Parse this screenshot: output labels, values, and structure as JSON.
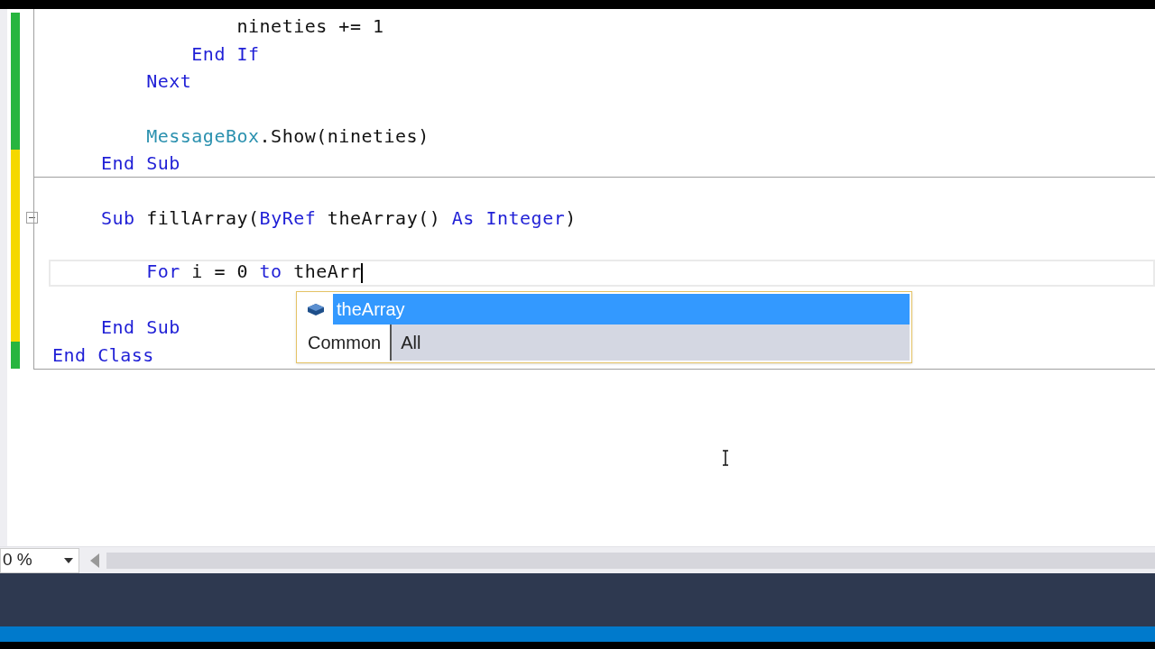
{
  "editor": {
    "lines": [
      {
        "unsaved": false,
        "tokens": [
          {
            "kind": "plain",
            "text": "            nineties += 1"
          }
        ]
      },
      {
        "unsaved": false,
        "tokens": [
          {
            "kind": "keyword",
            "text": "        End If"
          }
        ]
      },
      {
        "unsaved": false,
        "tokens": [
          {
            "kind": "keyword",
            "text": "    Next"
          }
        ]
      },
      {
        "unsaved": false
      },
      {
        "unsaved": false,
        "tokens": [
          {
            "kind": "type",
            "text": "    MessageBox"
          },
          {
            "kind": "plain",
            "text": ".Show(nineties)"
          }
        ]
      },
      {
        "unsaved": true,
        "tokens": [
          {
            "kind": "keyword",
            "text": "End Sub"
          }
        ]
      },
      {
        "unsaved": true,
        "separator": true
      },
      {
        "unsaved": true,
        "collapsible": true,
        "tokens": [
          {
            "kind": "keyword",
            "text": "Sub "
          },
          {
            "kind": "plain",
            "text": "fillArray("
          },
          {
            "kind": "keyword",
            "text": "ByRef "
          },
          {
            "kind": "plain",
            "text": "theArray() "
          },
          {
            "kind": "keyword",
            "text": "As Integer"
          },
          {
            "kind": "plain",
            "text": ")"
          }
        ]
      },
      {
        "unsaved": true
      },
      {
        "unsaved": true,
        "current": true,
        "tokens": [
          {
            "kind": "keyword",
            "text": "    For "
          },
          {
            "kind": "plain",
            "text": "i = 0 "
          },
          {
            "kind": "keyword",
            "text": "to "
          },
          {
            "kind": "plain",
            "text": "theArr"
          }
        ]
      },
      {
        "unsaved": true
      },
      {
        "unsaved": true,
        "tokens": [
          {
            "kind": "keyword",
            "text": "End Sub"
          }
        ]
      },
      {
        "unsaved": false,
        "outer": true,
        "tokens": [
          {
            "kind": "keyword",
            "text": "End Class"
          }
        ]
      }
    ]
  },
  "completion": {
    "items": [
      {
        "label": "theArray",
        "selected": true
      }
    ],
    "tabs": [
      {
        "label": "Common",
        "selected": true
      },
      {
        "label": "All",
        "selected": false
      }
    ]
  },
  "zoom": {
    "value": "0 %"
  }
}
